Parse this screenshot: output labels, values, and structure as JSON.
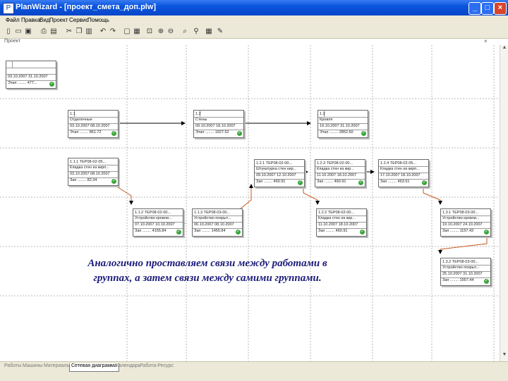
{
  "window": {
    "title": "PlanWizard - [проект_смета_доп.plw]",
    "buttons": [
      "_",
      "□",
      "×"
    ]
  },
  "menu": [
    "Файл",
    "Правка",
    "Вид",
    "Проект",
    "Сервис",
    "Помощь"
  ],
  "toolbar_icons": [
    "new-doc-icon",
    "open-folder-icon",
    "save-icon",
    "print-icon",
    "preview-icon",
    "cut-icon",
    "copy-icon",
    "paste-icon",
    "undo-icon",
    "redo-icon",
    "properties-icon",
    "table-icon",
    "link-icon",
    "zoom-in-icon",
    "zoom-out-icon",
    "find-icon",
    "filter-icon",
    "grid-icon",
    "wizard-icon"
  ],
  "project_strip": {
    "label": "Проект",
    "close": "×"
  },
  "nodes": [
    {
      "id": "n0",
      "r1": "",
      "r2": "",
      "r3": "03.10.2007 31.10.2007",
      "r4": "Этап  ........  477..."
    },
    {
      "id": "n1",
      "r1": "1.1",
      "r2": "Отделочные",
      "r3": "03.10.2007 08.10.2007",
      "r4": "Этап    ........   861.72"
    },
    {
      "id": "n2",
      "r1": "1.2",
      "r2": "Стены",
      "r3": "09.10.2007 18.10.2007",
      "r4": "Этап    ........   1927.52"
    },
    {
      "id": "n3",
      "r1": "1.3",
      "r2": "Кровля",
      "r3": "19.10.2007 31.10.2007",
      "r4": "Этап    ........   2852.60"
    },
    {
      "id": "n4",
      "r1": "1.1.1   ТЕР08-02-05...",
      "r2": "Кладка стен из кирп...",
      "r3": "03.10.2007 08.10.2007",
      "r4": "Зап    ........   82.34"
    },
    {
      "id": "n5",
      "r1": "1.2.1   ТЕР08-02-00...",
      "r2": "Штукатурка стен кир...",
      "r3": "09.10.2007 12.10.2007",
      "r4": "Зап    ........   460.91"
    },
    {
      "id": "n6",
      "r1": "1.2.3   ТЕР08-02-00...",
      "r2": "Кладка стен из кир...",
      "r3": "11.10.2007 18.10.2007",
      "r4": "Зап    ........   460.91"
    },
    {
      "id": "n7",
      "r1": "1.2.4   ТЕР08-02-05...",
      "r2": "Кладка стен из кирп...",
      "r3": "17.10.2007 18.10.2007",
      "r4": "Зап    ........   463.51"
    },
    {
      "id": "n8",
      "r1": "1.1.2   ТЕР08-02-00...",
      "r2": "Устройство кровли...",
      "r3": "07.10.2007 10.10.2007",
      "r4": "Зап    ........   4155.84"
    },
    {
      "id": "n9",
      "r1": "1.1.3   ТЕР08-03-00...",
      "r2": "Устройство покрыт...",
      "r3": "06.10.2007 08.10.2007",
      "r4": "Зап    ........   1455.84"
    },
    {
      "id": "n10",
      "r1": "1.2.2   ТЕР08-02-00...",
      "r2": "Кладка стен из кир...",
      "r3": "11.10.2007 18.10.2007",
      "r4": "Зап    ........   460.91"
    },
    {
      "id": "n11",
      "r1": "1.3.1   ТЕР08-03-00...",
      "r2": "Устройство кровли...",
      "r3": "19.10.2007 24.10.2007",
      "r4": "Зап    ........   1157.43"
    },
    {
      "id": "n12",
      "r1": "1.3.2   ТЕР08-03-00...",
      "r2": "Устройство покрыт...",
      "r3": "25.10.2007 31.10.2007",
      "r4": "Зап    ........   1557.44"
    }
  ],
  "caption": {
    "line1": "Аналогично  проставляем связи  между работами в",
    "line2": "группах, а затем связи между самими группами."
  },
  "tabs": [
    "Работы",
    "Машины",
    "Материалы",
    "Сетевая диаграмма",
    "Календарь",
    "Работа-Ресурс"
  ],
  "active_tab": "Сетевая диаграмма",
  "colors": {
    "titlebar": "#0a55dd",
    "caption": "#1b1b7a",
    "link_arrow": "#c85a1e",
    "ok_badge": "#3aa53a"
  }
}
